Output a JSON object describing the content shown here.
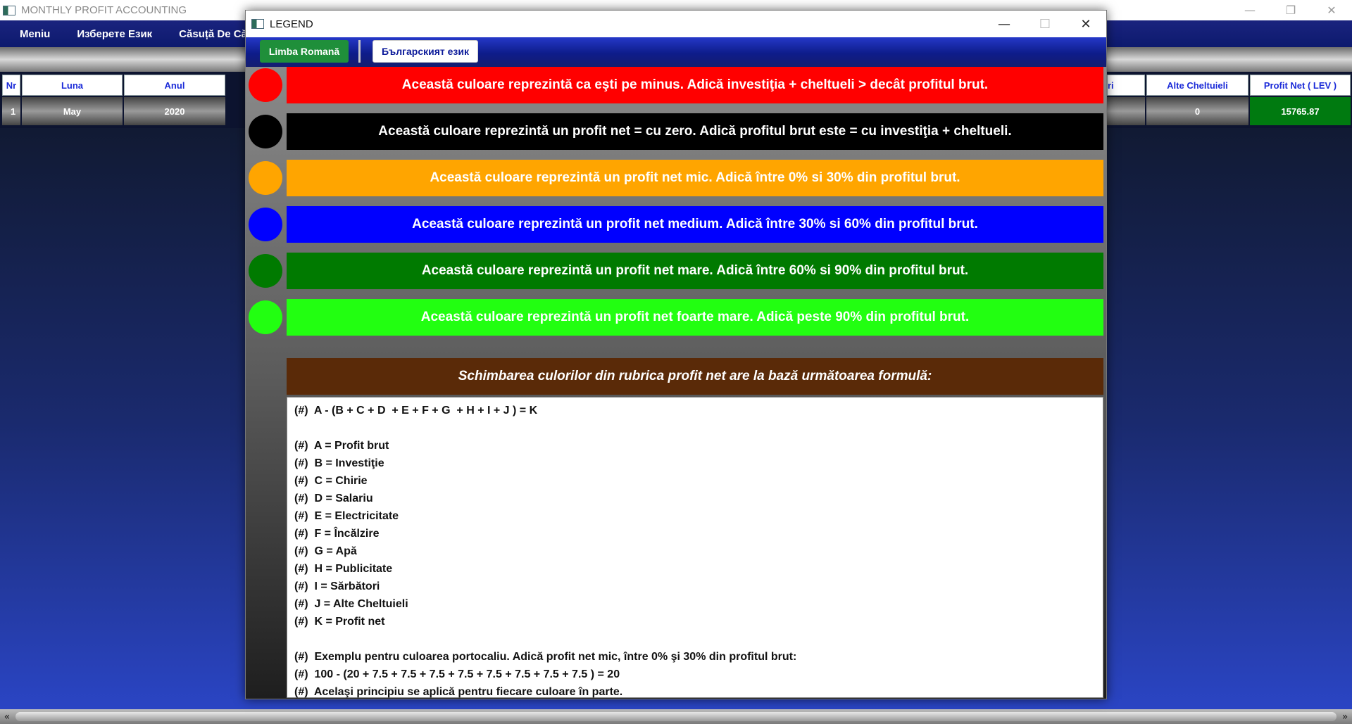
{
  "main_window": {
    "title": "MONTHLY PROFIT ACCOUNTING",
    "controls": [
      "—",
      "❐",
      "✕"
    ],
    "menu": [
      "Meniu",
      "Изберете Език",
      "Căsuță De Că"
    ],
    "table": {
      "headers_left": [
        "Nr",
        "Luna",
        "Anul"
      ],
      "headers_right": [
        "ri",
        "Alte Cheltuieli",
        "Profit Net ( LEV )"
      ],
      "row_left": [
        "1",
        "May",
        "2020"
      ],
      "row_right": [
        "",
        "0",
        "15765.87"
      ],
      "profit_color": "#007a10"
    },
    "scroll_arrows": [
      "«",
      "»"
    ]
  },
  "legend": {
    "title": "LEGEND",
    "controls": [
      "—",
      "☐",
      "✕"
    ],
    "languages": [
      "Limba Romană",
      "Българският език"
    ],
    "rows": [
      {
        "color": "#ff0000",
        "text": "Această culoare reprezintă ca eşti pe minus. Adică investiţia + cheltueli > decât profitul brut."
      },
      {
        "color": "#000000",
        "text": "Această culoare reprezintă un profit net = cu zero. Adică profitul brut este = cu investiţia + cheltueli."
      },
      {
        "color": "#ffa500",
        "text": "Această culoare reprezintă un profit net mic. Adică între 0% si 30% din profitul brut."
      },
      {
        "color": "#0000ff",
        "text": "Această culoare reprezintă un profit net medium. Adică între 30% si 60% din profitul brut."
      },
      {
        "color": "#007a00",
        "text": "Această culoare reprezintă un profit net mare. Adică între 60% si 90% din profitul brut."
      },
      {
        "color": "#22ff11",
        "text": "Această culoare reprezintă un profit net foarte mare. Adică peste 90% din profitul brut."
      }
    ],
    "formula_title": "Schimbarea culorilor din rubrica profit net are la bază următoarea formulă:",
    "formula_lines": [
      "(#)  A - (B + C + D  + E + F + G  + H + I + J ) = K",
      "",
      "(#)  A = Profit brut",
      "(#)  B = Investiţie",
      "(#)  C = Chirie",
      "(#)  D = Salariu",
      "(#)  E = Electricitate",
      "(#)  F = Încălzire",
      "(#)  G = Apă",
      "(#)  H = Publicitate",
      "(#)  I = Sărbători",
      "(#)  J = Alte Cheltuieli",
      "(#)  K = Profit net",
      "",
      "(#)  Exemplu pentru culoarea portocaliu. Adică profit net mic, între 0% şi 30% din profitul brut:",
      "(#)  100 - (20 + 7.5 + 7.5 + 7.5 + 7.5 + 7.5 + 7.5 + 7.5 + 7.5 ) = 20",
      "(#)  Acelaşi principiu se aplică pentru fiecare culoare în parte."
    ]
  }
}
